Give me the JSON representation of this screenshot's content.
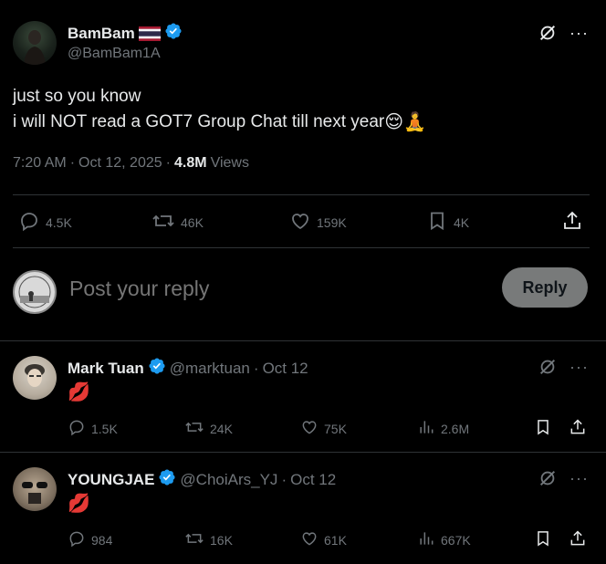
{
  "colors": {
    "accent": "#1d9bf0",
    "muted": "#71767b",
    "reply_bg": "#787a7a",
    "background": "#000000"
  },
  "main_post": {
    "display_name": "BamBam",
    "flag": "🇹🇭",
    "handle": "@BamBam1A",
    "text_line1": "just so you know",
    "text_line2": "i will NOT read a GOT7 Group Chat till next year",
    "emojis": "😌🧘",
    "time": "7:20 AM",
    "date": "Oct 12, 2025",
    "views_count": "4.8M",
    "views_label": "Views",
    "stats": {
      "replies": "4.5K",
      "reposts": "46K",
      "likes": "159K",
      "bookmarks": "4K"
    }
  },
  "reply_box": {
    "placeholder": "Post your reply",
    "button_label": "Reply"
  },
  "replies": [
    {
      "display_name": "Mark Tuan",
      "handle": "@marktuan",
      "date": "Oct 12",
      "text": "💋",
      "stats": {
        "replies": "1.5K",
        "reposts": "24K",
        "likes": "75K",
        "views": "2.6M"
      }
    },
    {
      "display_name": "YOUNGJAE",
      "handle": "@ChoiArs_YJ",
      "date": "Oct 12",
      "text": "💋",
      "stats": {
        "replies": "984",
        "reposts": "16K",
        "likes": "61K",
        "views": "667K"
      }
    }
  ]
}
